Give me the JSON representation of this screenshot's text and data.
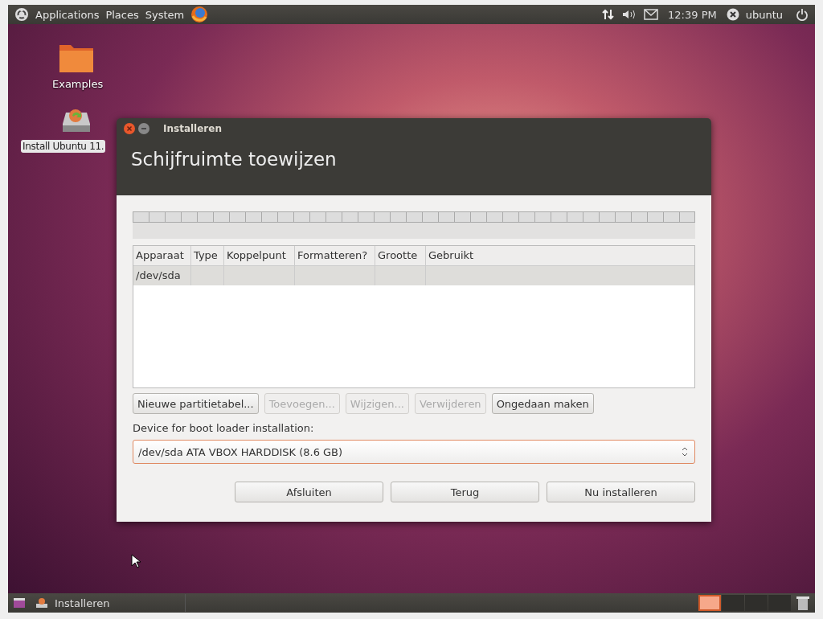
{
  "top_panel": {
    "menus": [
      "Applications",
      "Places",
      "System"
    ],
    "clock": "12:39 PM",
    "user": "ubuntu"
  },
  "desktop_icons": [
    {
      "label": "Examples",
      "kind": "folder",
      "selected": false
    },
    {
      "label": "Install Ubuntu 11.",
      "kind": "installer",
      "selected": true
    }
  ],
  "window": {
    "title": "Installeren",
    "heading": "Schijfruimte toewijzen",
    "table": {
      "columns": [
        "Apparaat",
        "Type",
        "Koppelpunt",
        "Formatteren?",
        "Grootte",
        "Gebruikt"
      ],
      "rows": [
        {
          "device": "/dev/sda",
          "selected": true
        }
      ]
    },
    "partition_buttons": [
      {
        "label": "Nieuwe partitietabel...",
        "disabled": false
      },
      {
        "label": "Toevoegen...",
        "disabled": true
      },
      {
        "label": "Wijzigen...",
        "disabled": true
      },
      {
        "label": "Verwijderen",
        "disabled": true
      },
      {
        "label": "Ongedaan maken",
        "disabled": false
      }
    ],
    "boot_loader_label": "Device for boot loader installation:",
    "boot_loader_device": "/dev/sda ATA VBOX HARDDISK (8.6 GB)",
    "buttons": [
      "Afsluiten",
      "Terug",
      "Nu installeren"
    ]
  },
  "taskbar": {
    "tasks": [
      {
        "label": "Installeren"
      }
    ],
    "workspaces": [
      {
        "selected": true
      },
      {
        "selected": false
      },
      {
        "selected": false
      },
      {
        "selected": false
      }
    ]
  }
}
